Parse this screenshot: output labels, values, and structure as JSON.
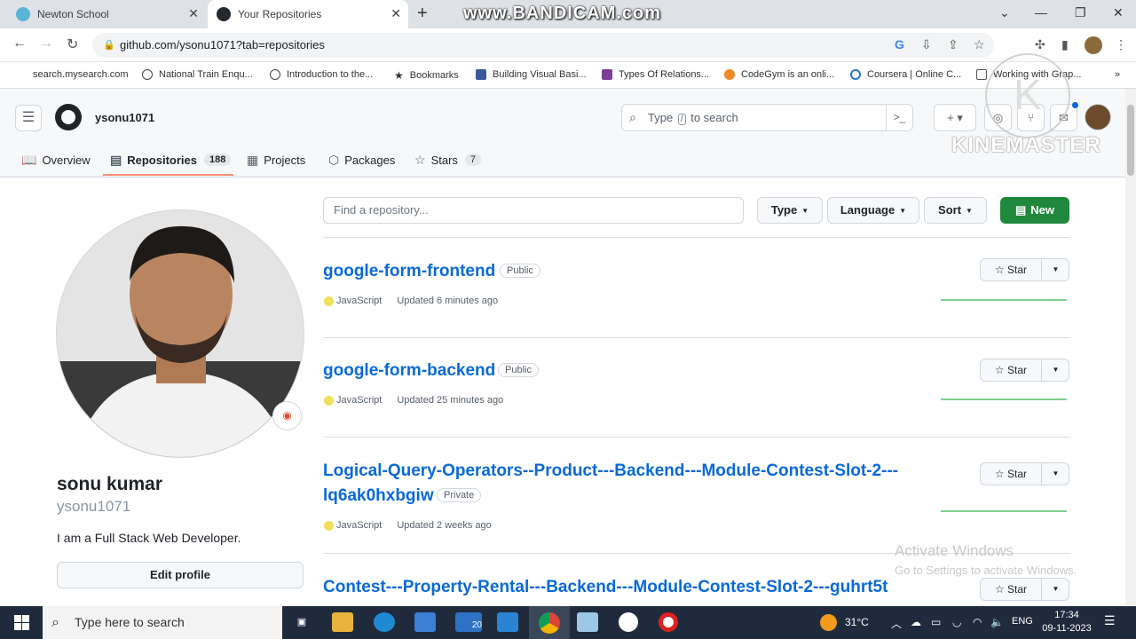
{
  "browser": {
    "tabs": [
      {
        "title": "Newton School"
      },
      {
        "title": "Your Repositories"
      }
    ],
    "url": "github.com/ysonu1071?tab=repositories",
    "bookmarks": [
      "search.mysearch.com",
      "National Train Enqu...",
      "Introduction to the...",
      "Bookmarks",
      "Building Visual Basi...",
      "Types Of Relations...",
      "CodeGym is an onli...",
      "Coursera | Online C...",
      "Working with Grap..."
    ],
    "overlay_bandicam": "www.BANDICAM.com",
    "overlay_kinemaster": "KINEMASTER",
    "overlay_k": "K"
  },
  "github": {
    "username": "ysonu1071",
    "search_placeholder_pre": "Type",
    "search_key": "/",
    "search_placeholder_post": "to search",
    "nav": [
      {
        "label": "Overview",
        "count": ""
      },
      {
        "label": "Repositories",
        "count": "188"
      },
      {
        "label": "Projects",
        "count": ""
      },
      {
        "label": "Packages",
        "count": ""
      },
      {
        "label": "Stars",
        "count": "7"
      }
    ],
    "profile": {
      "name": "sonu kumar",
      "login": "ysonu1071",
      "bio": "I am a Full Stack Web Developer.",
      "edit_label": "Edit profile"
    },
    "filters": {
      "find_placeholder": "Find a repository...",
      "type_label": "Type",
      "language_label": "Language",
      "sort_label": "Sort",
      "new_label": "New"
    },
    "repos": [
      {
        "name": "google-form-frontend",
        "name2": "",
        "visibility": "Public",
        "language": "JavaScript",
        "updated": "Updated 6 minutes ago"
      },
      {
        "name": "google-form-backend",
        "name2": "",
        "visibility": "Public",
        "language": "JavaScript",
        "updated": "Updated 25 minutes ago"
      },
      {
        "name": "Logical-Query-Operators--Product---Backend---Module-Contest-Slot-2---",
        "name2": "lq6ak0hxbgiw",
        "visibility": "Private",
        "language": "JavaScript",
        "updated": "Updated 2 weeks ago"
      },
      {
        "name": "Contest---Property-Rental---Backend---Module-Contest-Slot-2---guhrt5t",
        "name2": "",
        "visibility": "",
        "language": "",
        "updated": ""
      }
    ],
    "star_label": "Star",
    "language_color": "#f1e05a"
  },
  "windows": {
    "activate_title": "Activate Windows",
    "activate_sub": "Go to Settings to activate Windows.",
    "taskbar_search": "Type here to search",
    "mail_badge": "20",
    "temperature": "31°C",
    "lang": "ENG",
    "time": "17:34",
    "date": "09-11-2023"
  }
}
